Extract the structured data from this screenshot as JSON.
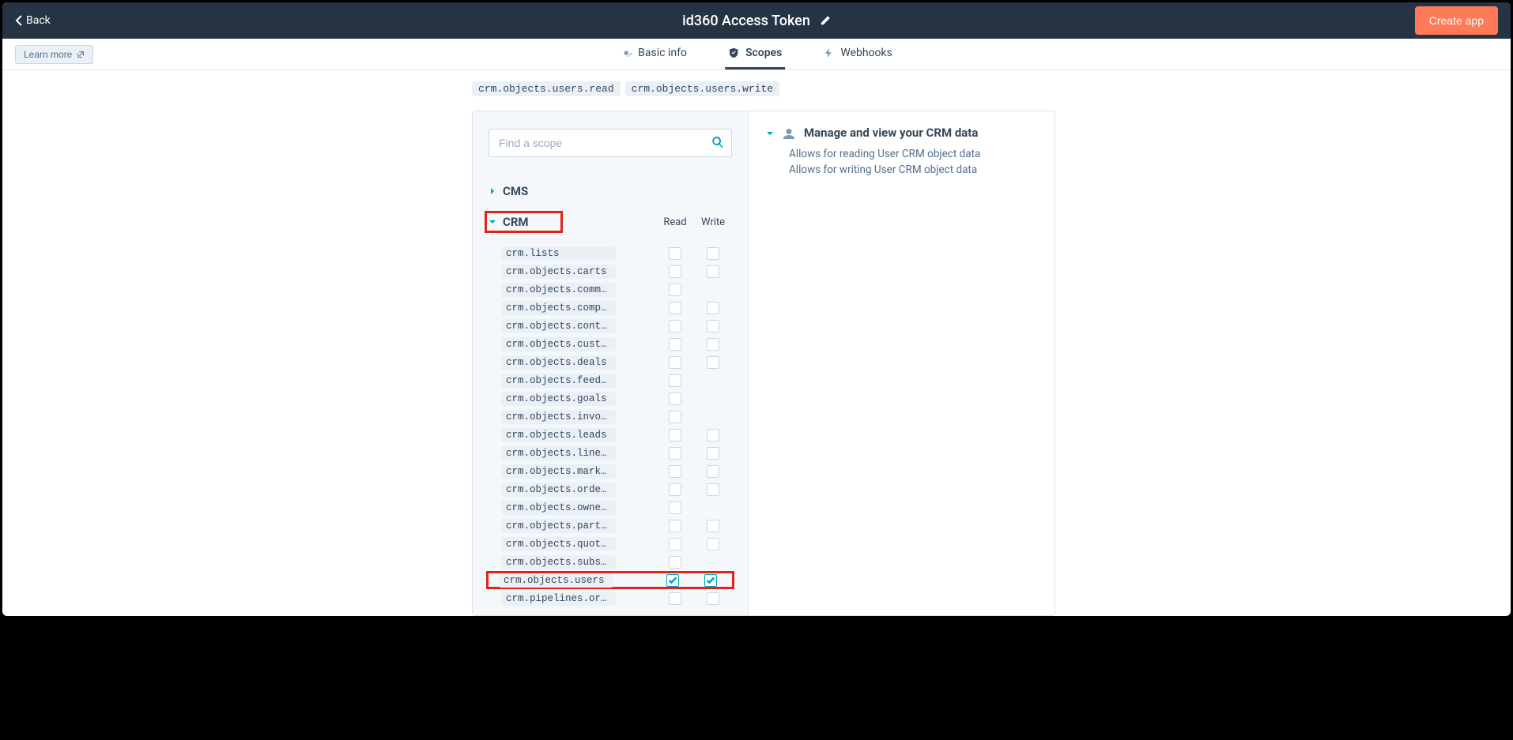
{
  "header": {
    "back_label": "Back",
    "title": "id360 Access Token",
    "create_label": "Create app"
  },
  "subbar": {
    "learn_label": "Learn more"
  },
  "tabs": {
    "basic": "Basic info",
    "scopes": "Scopes",
    "webhooks": "Webhooks"
  },
  "tags": {
    "t1": "crm.objects.users.read",
    "t2": "crm.objects.users.write"
  },
  "search": {
    "placeholder": "Find a scope"
  },
  "cats": {
    "cms": "CMS",
    "crm": "CRM"
  },
  "cols": {
    "read": "Read",
    "write": "Write"
  },
  "scopes": {
    "s0": "crm.lists",
    "s1": "crm.objects.carts",
    "s2": "crm.objects.commerc…",
    "s3": "crm.objects.compani…",
    "s4": "crm.objects.contacts",
    "s5": "crm.objects.custom",
    "s6": "crm.objects.deals",
    "s7": "crm.objects.feedbac…",
    "s8": "crm.objects.goals",
    "s9": "crm.objects.invoices",
    "s10": "crm.objects.leads",
    "s11": "crm.objects.line_it…",
    "s12": "crm.objects.marketi…",
    "s13": "crm.objects.orders",
    "s14": "crm.objects.owners",
    "s15": "crm.objects.partner…",
    "s16": "crm.objects.quotes",
    "s17": "crm.objects.subscri…",
    "s18": "crm.objects.users",
    "s19": "crm.pipelines.orders"
  },
  "info": {
    "title": "Manage and view your CRM data",
    "line1": "Allows for reading User CRM object data",
    "line2": "Allows for writing User CRM object data"
  }
}
